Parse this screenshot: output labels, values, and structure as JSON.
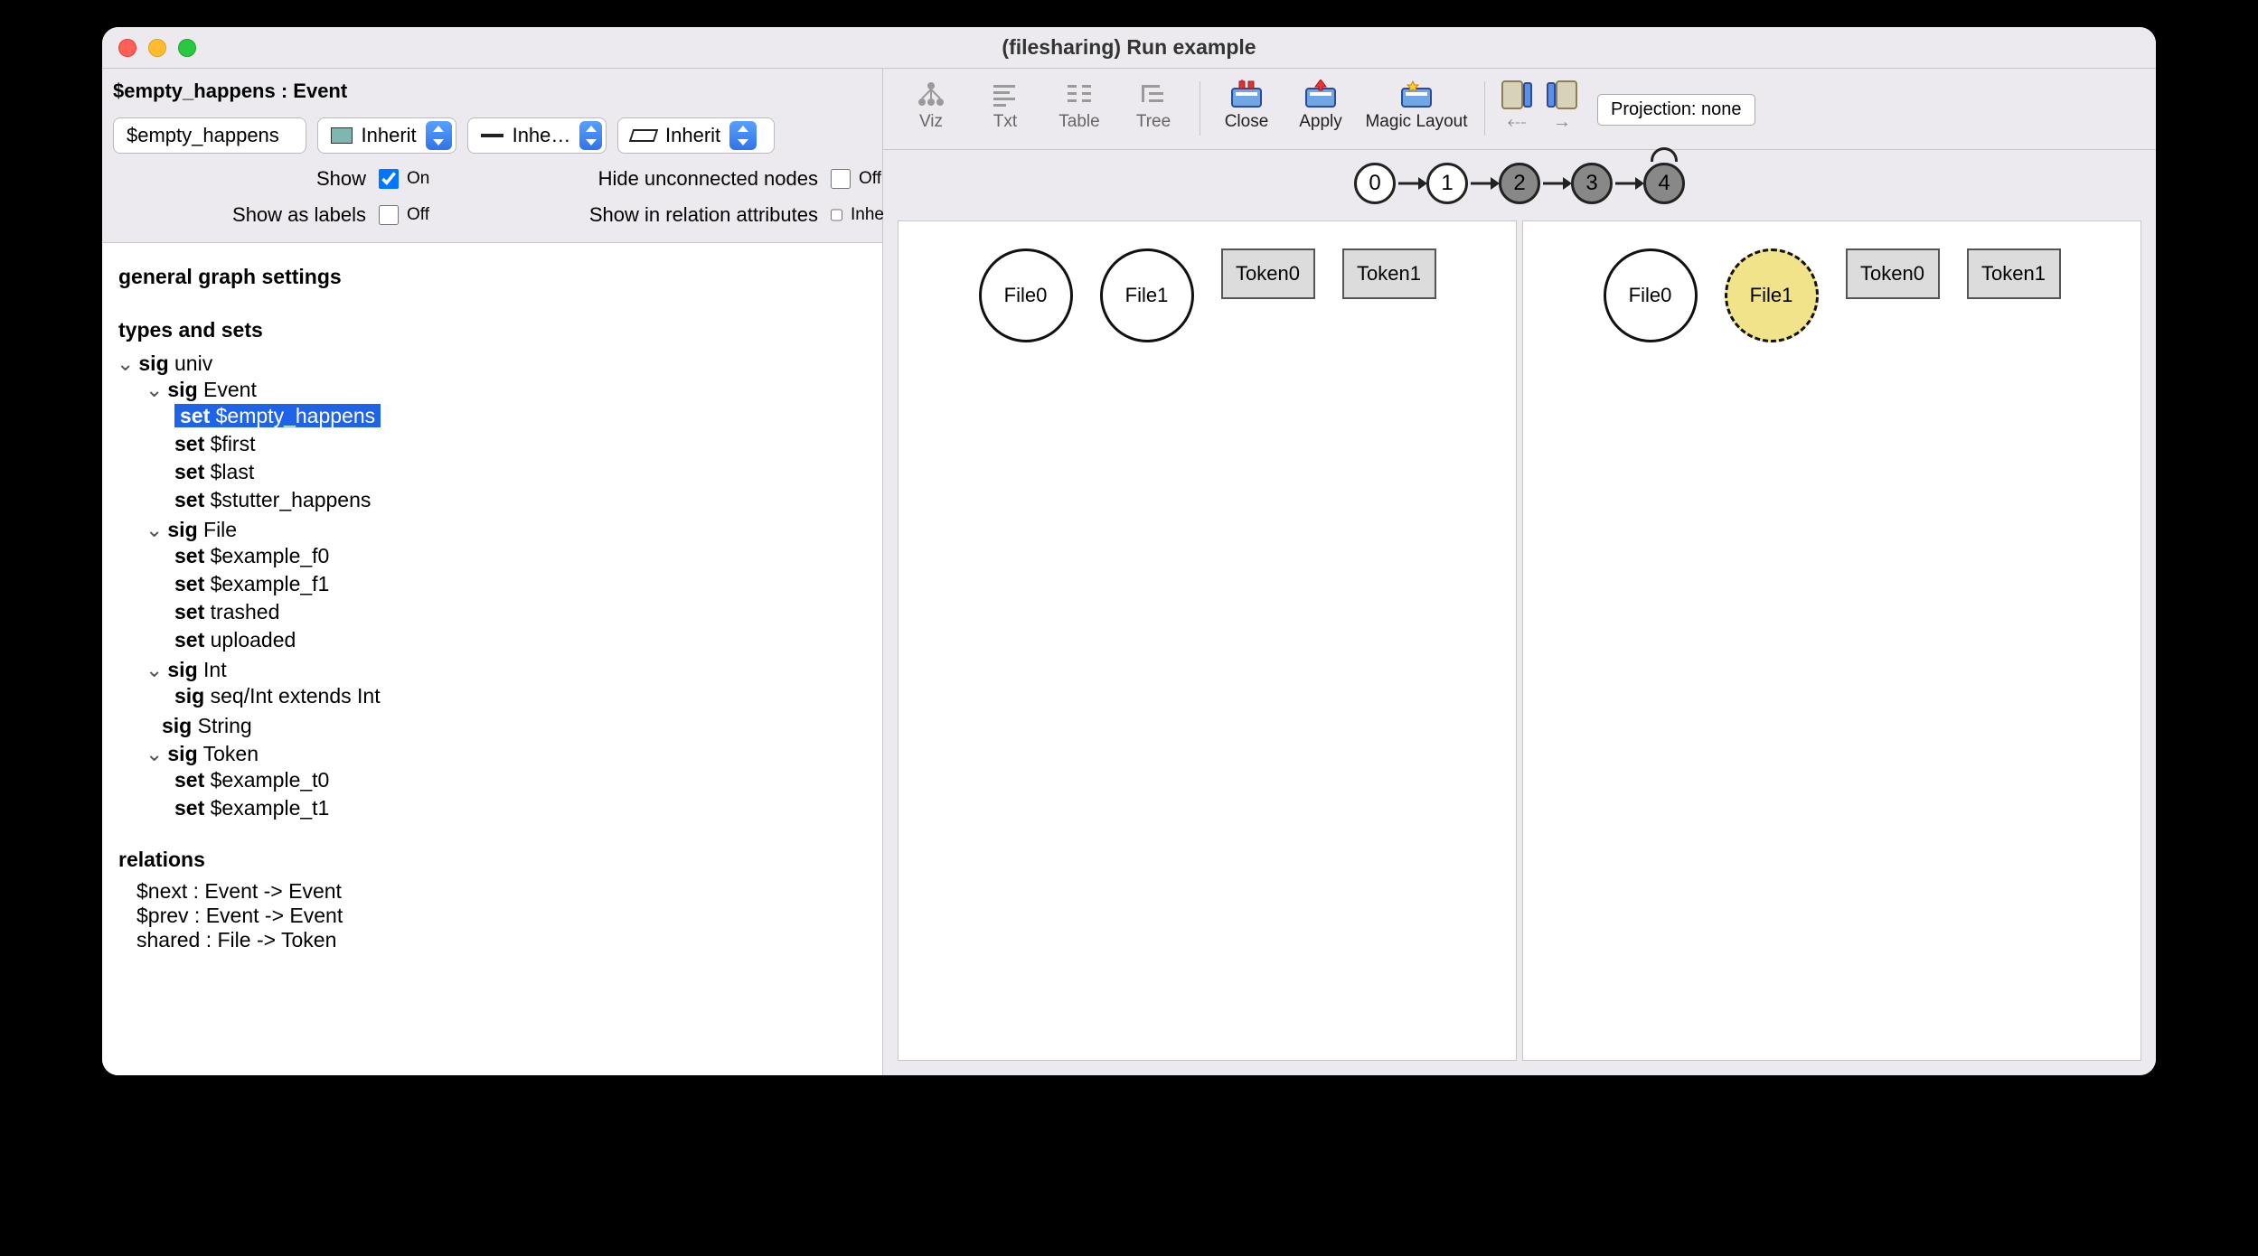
{
  "window": {
    "title": "(filesharing) Run example"
  },
  "inspector": {
    "breadcrumb": "$empty_happens :   Event",
    "name_field": "$empty_happens",
    "color_combo": "Inherit",
    "line_combo": "Inhe…",
    "shape_combo": "Inherit",
    "labels": {
      "show": "Show",
      "show_val": "On",
      "hide_unconnected": "Hide unconnected nodes",
      "hide_unconnected_val": "Off",
      "show_as_labels": "Show as labels",
      "show_as_labels_val": "Off",
      "show_in_relation": "Show in relation attributes",
      "show_in_relation_val": "Inherited"
    }
  },
  "tree": {
    "general": "general graph settings",
    "types_title": "types and sets",
    "relations_title": "relations",
    "nodes": {
      "univ": "univ",
      "event": "Event",
      "empty_happens": "$empty_happens",
      "first": "$first",
      "last": "$last",
      "stutter_happens": "$stutter_happens",
      "file": "File",
      "example_f0": "$example_f0",
      "example_f1": "$example_f1",
      "trashed": "trashed",
      "uploaded": "uploaded",
      "int": "Int",
      "seqint": "seq/Int extends Int",
      "string": "String",
      "token": "Token",
      "example_t0": "$example_t0",
      "example_t1": "$example_t1"
    },
    "kw": {
      "sig": "sig",
      "set": "set"
    },
    "relations": {
      "next": "$next :   Event -> Event",
      "prev": "$prev :   Event -> Event",
      "shared": "shared :   File -> Token"
    }
  },
  "toolbar": {
    "viz": "Viz",
    "txt": "Txt",
    "table": "Table",
    "tree": "Tree",
    "close": "Close",
    "apply": "Apply",
    "magic": "Magic Layout",
    "projection": "Projection: none",
    "nav_prev": "⤎",
    "nav_next": "→"
  },
  "timeline": {
    "states": [
      "0",
      "1",
      "2",
      "3",
      "4"
    ]
  },
  "graph": {
    "left": {
      "nodes": [
        {
          "label": "File0",
          "shape": "ellipse"
        },
        {
          "label": "File1",
          "shape": "ellipse"
        },
        {
          "label": "Token0",
          "shape": "rect"
        },
        {
          "label": "Token1",
          "shape": "rect"
        }
      ]
    },
    "right": {
      "nodes": [
        {
          "label": "File0",
          "shape": "ellipse"
        },
        {
          "label": "File1",
          "shape": "ellipse-hl"
        },
        {
          "label": "Token0",
          "shape": "rect"
        },
        {
          "label": "Token1",
          "shape": "rect"
        }
      ]
    }
  }
}
